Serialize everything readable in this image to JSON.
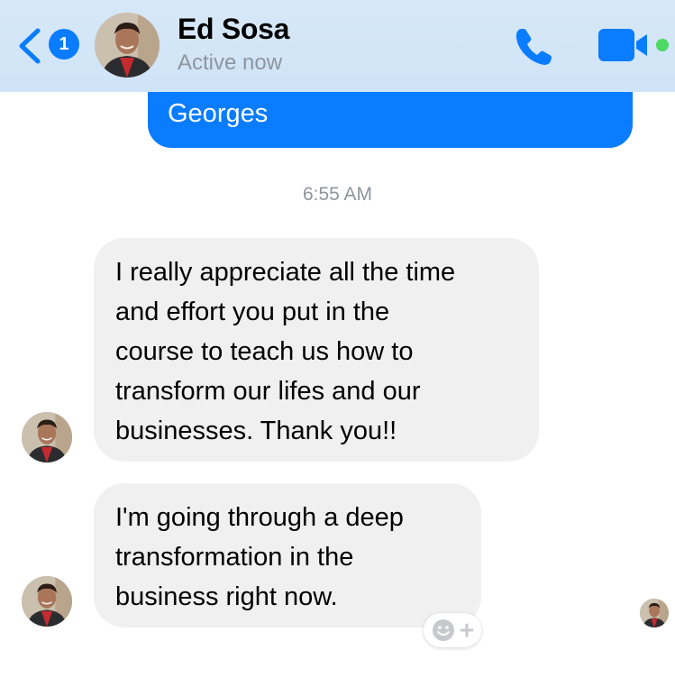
{
  "header": {
    "unread_count": "1",
    "contact_name": "Ed Sosa",
    "status": "Active now",
    "icons": {
      "back": "chevron-left-icon",
      "call": "phone-icon",
      "video": "video-camera-icon"
    }
  },
  "thread": {
    "sent_message": {
      "text": "Georges"
    },
    "timestamp": "6:55 AM",
    "received_messages": [
      {
        "lines": [
          "I really appreciate all the time",
          "and effort you put in the",
          "course to teach us how to",
          "transform our lifes and our",
          "businesses. Thank you!!"
        ]
      },
      {
        "lines": [
          "I'm going through a deep",
          "transformation in the",
          "business right now."
        ]
      }
    ],
    "reaction_icon": "smiley-plus-icon"
  },
  "colors": {
    "accent": "#0a7cff",
    "header_bg": "#d7e8f7",
    "received_bubble": "#f1f0f0",
    "muted_text": "#8e959d",
    "online": "#4cd964"
  }
}
